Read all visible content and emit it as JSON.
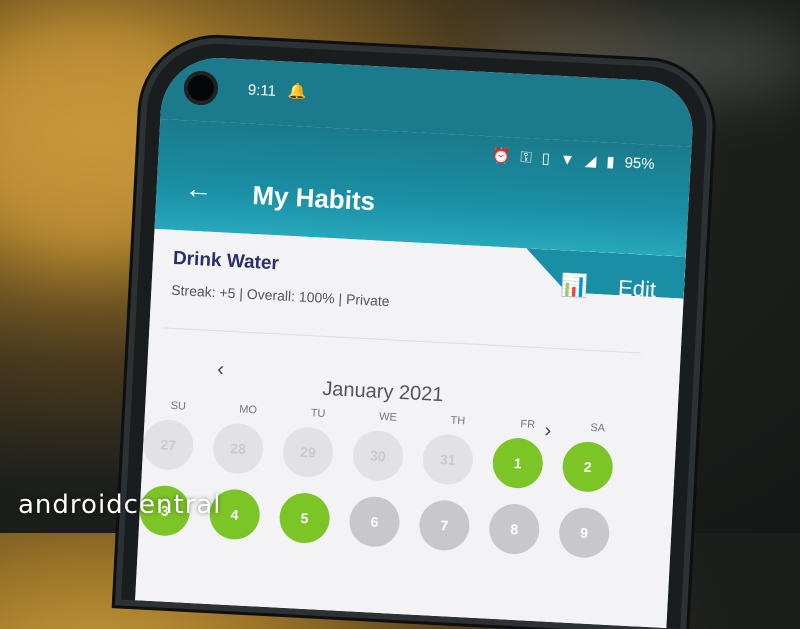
{
  "status": {
    "time": "9:11",
    "battery": "95%",
    "icons": [
      "alarm-icon",
      "vpn-key-icon",
      "vibrate-icon",
      "wifi-icon",
      "signal-icon",
      "battery-icon"
    ]
  },
  "appbar": {
    "title": "My Habits",
    "edit_label": "Edit"
  },
  "habit": {
    "name": "Drink Water",
    "meta": "Streak: +5 | Overall: 100% | Private"
  },
  "calendar": {
    "month": "January 2021",
    "weekdays": [
      "SU",
      "MO",
      "TU",
      "WE",
      "TH",
      "FR",
      "SA"
    ],
    "rows": [
      [
        {
          "label": "27",
          "state": "past"
        },
        {
          "label": "28",
          "state": "past"
        },
        {
          "label": "29",
          "state": "past"
        },
        {
          "label": "30",
          "state": "past"
        },
        {
          "label": "31",
          "state": "past"
        },
        {
          "label": "1",
          "state": "done"
        },
        {
          "label": "2",
          "state": "done"
        }
      ],
      [
        {
          "label": "3",
          "state": "done"
        },
        {
          "label": "4",
          "state": "done"
        },
        {
          "label": "5",
          "state": "done"
        },
        {
          "label": "6",
          "state": "todo"
        },
        {
          "label": "7",
          "state": "todo"
        },
        {
          "label": "8",
          "state": "todo"
        },
        {
          "label": "9",
          "state": "todo"
        }
      ]
    ]
  },
  "watermark": "androidcentral",
  "colors": {
    "appbar": "#1b7a8c",
    "done": "#7cc526",
    "habit_title": "#2a2f6b"
  }
}
